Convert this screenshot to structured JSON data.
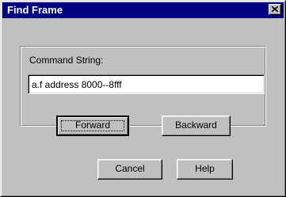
{
  "window": {
    "title": "Find Frame",
    "close_icon": "close-icon"
  },
  "form": {
    "label": "Command String:",
    "value": "a.f address 8000--8fff"
  },
  "buttons": {
    "forward": "Forward",
    "backward": "Backward",
    "cancel": "Cancel",
    "help": "Help"
  },
  "colors": {
    "titlebar": "#000080",
    "face": "#c0c0c0"
  }
}
